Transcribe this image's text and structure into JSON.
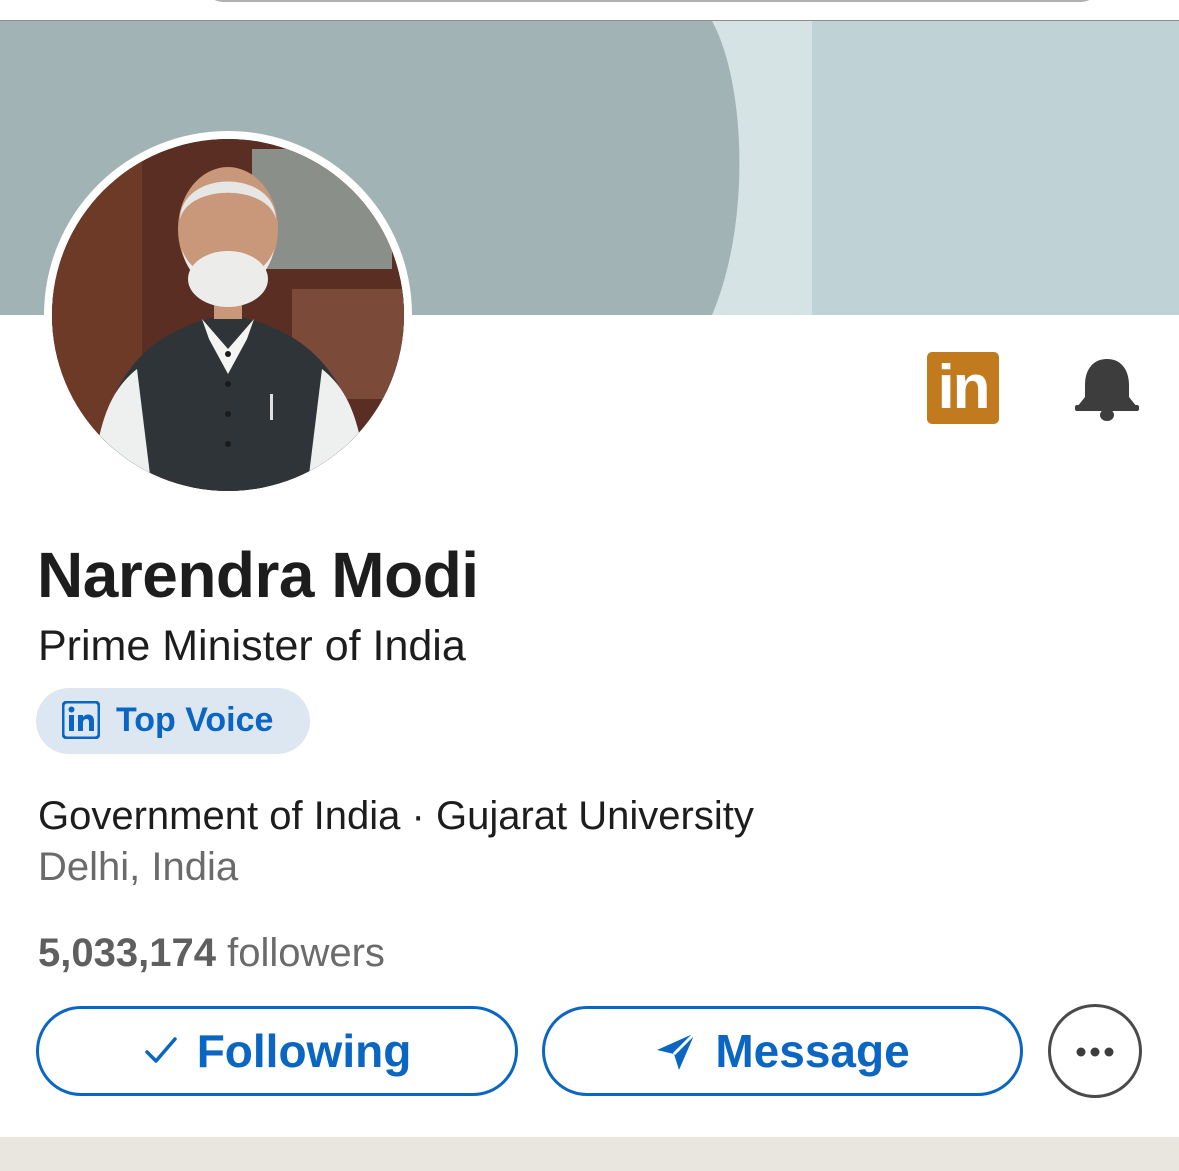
{
  "profile": {
    "name": "Narendra Modi",
    "headline": "Prime Minister of India",
    "badge": {
      "label": "Top Voice"
    },
    "organizations": "Government of India · Gujarat University",
    "location": "Delhi, India",
    "followers_count": "5,033,174",
    "followers_label": "followers"
  },
  "header_icons": {
    "linkedin": {
      "icon": "linkedin-logo-icon",
      "text": "in",
      "color": "#c27a1e"
    },
    "notifications": {
      "icon": "bell-icon"
    }
  },
  "actions": {
    "following_label": "Following",
    "following_icon": "checkmark-icon",
    "message_label": "Message",
    "message_icon": "send-icon",
    "more_icon": "more-horizontal-icon"
  },
  "colors": {
    "accent": "#0a66c2",
    "banner_dark": "#a2b3b5",
    "banner_light": "#bfd2d6",
    "badge_bg": "#dde7f1"
  }
}
